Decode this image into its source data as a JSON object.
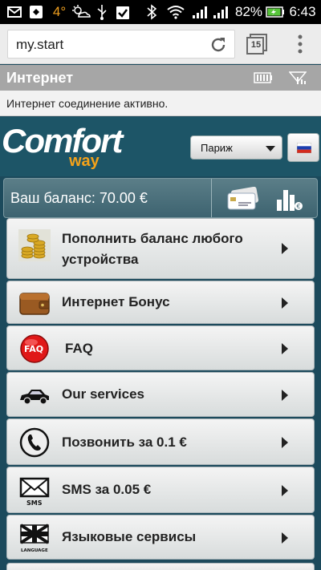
{
  "status_bar": {
    "temperature": "4°",
    "battery_percent": "82%",
    "time": "6:43",
    "icons": [
      "mail-icon",
      "photo-icon",
      "weather-icon",
      "usb-icon",
      "clipboard-icon",
      "bluetooth-icon",
      "wifi-icon",
      "signal-icon",
      "signal-icon",
      "battery-charging-icon"
    ]
  },
  "browser": {
    "url": "my.start",
    "tabs_count": "15"
  },
  "notification": {
    "title": "Интернет",
    "message": "Интернет соединение активно."
  },
  "header": {
    "logo_word1": "Comfort",
    "logo_word2": "way",
    "city": "Париж",
    "accent": "#f4a21a"
  },
  "balance": {
    "label": "Ваш баланс: 70.00 €"
  },
  "menu": {
    "items": [
      {
        "label": "Пополнить баланс любого устройства",
        "icon": "coins-icon"
      },
      {
        "label": "Интернет Бонус",
        "icon": "wallet-icon"
      },
      {
        "label": "FAQ",
        "icon": "faq-icon"
      },
      {
        "label": "Our services",
        "icon": "car-icon"
      },
      {
        "label": "Позвонить за 0.1 €",
        "icon": "phone-icon"
      },
      {
        "label": "SMS за 0.05 €",
        "icon": "sms-icon"
      },
      {
        "label": "Языковые сервисы",
        "icon": "language-icon"
      }
    ]
  }
}
